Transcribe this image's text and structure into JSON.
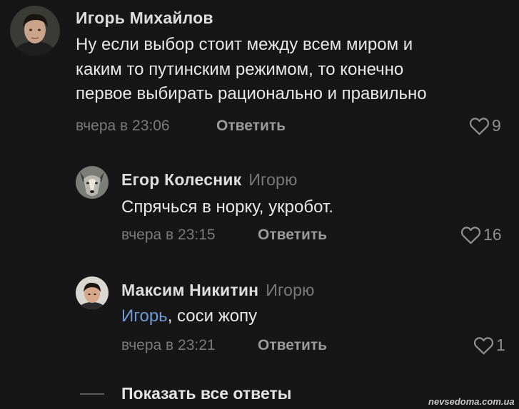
{
  "comments": [
    {
      "author": "Игорь Михайлов",
      "reply_to": "",
      "lines": [
        "Ну если выбор стоит между всем миром и",
        "каким то путинским режимом, то конечно",
        "первое выбирать рационально и правильно"
      ],
      "time": "вчера в 23:06",
      "reply_label": "Ответить",
      "likes": "9"
    },
    {
      "author": "Егор Колесник",
      "reply_to": "Игорю",
      "lines": [
        "Спрячься в норку, укробот."
      ],
      "time": "вчера в 23:15",
      "reply_label": "Ответить",
      "likes": "16"
    },
    {
      "author": "Максим Никитин",
      "reply_to": "Игорю",
      "mention": "Игорь",
      "text_after_mention": ", соси жопу",
      "time": "вчера в 23:21",
      "reply_label": "Ответить",
      "likes": "1"
    }
  ],
  "show_all_label": "Показать все ответы",
  "watermark": "nevsedoma.com.ua",
  "colors": {
    "background": "#161616",
    "mention": "#6f9ad6",
    "muted": "#7a7a7a"
  },
  "icons": {
    "like": "heart-outline-icon"
  }
}
